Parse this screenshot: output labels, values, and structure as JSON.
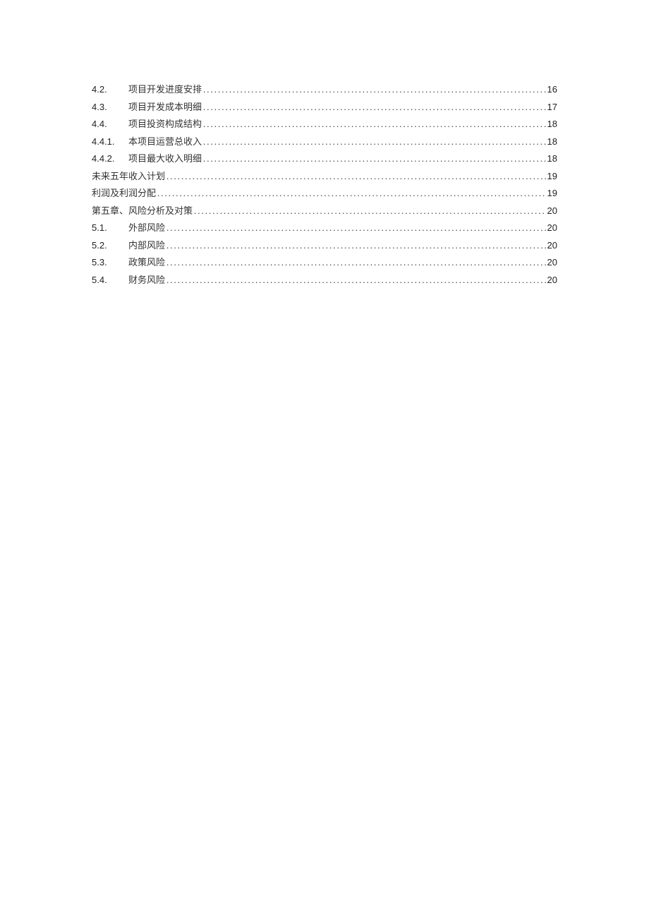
{
  "entries": [
    {
      "number": "4.2.",
      "title": "项目开发进度安排",
      "page": "16",
      "indent": true
    },
    {
      "number": "4.3.",
      "title": "项目开发成本明细",
      "page": "17",
      "indent": true
    },
    {
      "number": "4.4.",
      "title": "项目投资构成结构",
      "page": "18",
      "indent": true
    },
    {
      "number": "4.4.1.",
      "title": "本项目运营总收入",
      "page": "18",
      "indent": true
    },
    {
      "number": "4.4.2.",
      "title": "项目最大收入明细",
      "page": "18",
      "indent": true
    },
    {
      "number": "",
      "title": "未来五年收入计划",
      "page": "19",
      "indent": false
    },
    {
      "number": "",
      "title": "利润及利润分配",
      "page": "19",
      "indent": false
    },
    {
      "number": "",
      "title": "第五章、风险分析及对策",
      "page": "20",
      "indent": false
    },
    {
      "number": "5.1.",
      "title": "外部风险",
      "page": "20",
      "indent": true
    },
    {
      "number": "5.2.",
      "title": "内部风险",
      "page": "20",
      "indent": true
    },
    {
      "number": "5.3.",
      "title": "政策风险",
      "page": "20",
      "indent": true
    },
    {
      "number": "5.4.",
      "title": "财务风险",
      "page": "20",
      "indent": true
    }
  ]
}
